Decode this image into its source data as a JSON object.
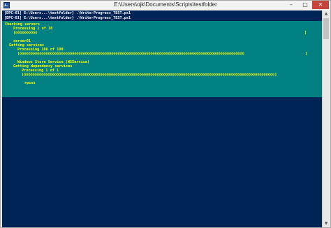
{
  "window": {
    "title": "E:\\Users\\ojk\\Documents\\Scripts\\testfolder",
    "minimize_glyph": "–",
    "maximize_glyph": "□",
    "close_glyph": "✕"
  },
  "console": {
    "lines": [
      "[DPC-01] E:\\Users...\\testfolder} .\\Write-Progress_TEST.ps1",
      "[DPC-01] E:\\Users...\\testfolder} .\\Write-Progress_TEST.ps1"
    ]
  },
  "progress": {
    "block1": {
      "heading": "Checking servers",
      "status": "Processing 1 of 10",
      "bar": "[oooooooooo",
      "bar_end": "]",
      "fraction": 0.1
    },
    "block2": {
      "server": "server01",
      "heading": "Getting services",
      "status": "Processing 106 of 190",
      "bar": "[ooooooooooooooooooooooooooooooooooooooooooooooooooooooooooooooooooooooooooooooooooooooooooooooooooooooo",
      "bar_end": "]",
      "fraction": 0.558
    },
    "block3": {
      "service": "Windows Store Service (WSService)",
      "heading": "Getting dependency services",
      "status": "Processing 1 of 1",
      "bar": "[ooooooooooooooooooooooooooooooooooooooooooooooooooooooooooooooooooooooooooooooooooooooooooooooooooooooooooooooooooo]",
      "fraction": 1.0
    },
    "item": "rpcss"
  },
  "colors": {
    "console_bg": "#012456",
    "progress_bg": "#008080",
    "progress_text": "#ffff00",
    "console_text": "#ffffff"
  }
}
